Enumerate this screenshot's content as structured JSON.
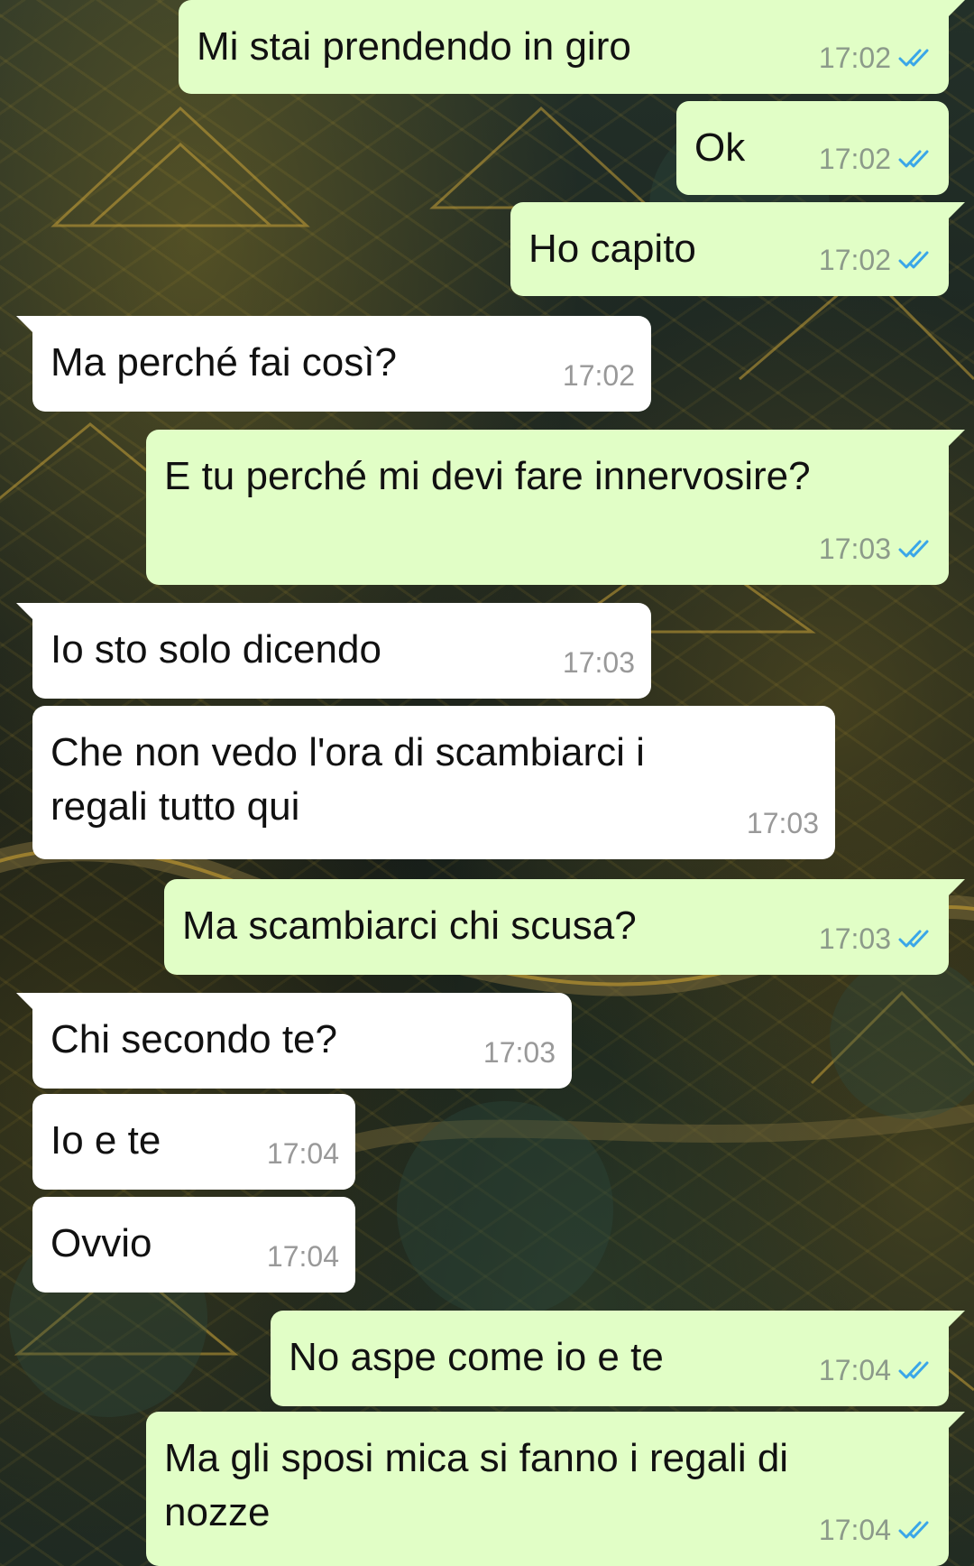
{
  "messages": [
    {
      "dir": "out",
      "text": "Mi stai prendendo in giro",
      "time": "17:02",
      "status": "read"
    },
    {
      "dir": "out",
      "text": "Ok",
      "time": "17:02",
      "status": "read"
    },
    {
      "dir": "out",
      "text": "Ho capito",
      "time": "17:02",
      "status": "read"
    },
    {
      "dir": "in",
      "text": "Ma perché fai così?",
      "time": "17:02"
    },
    {
      "dir": "out",
      "text": "E tu perché mi devi fare innervosire?",
      "time": "17:03",
      "status": "read"
    },
    {
      "dir": "in",
      "text": "Io sto solo dicendo",
      "time": "17:03"
    },
    {
      "dir": "in",
      "text": "Che non vedo l'ora di scambiarci i regali tutto qui",
      "time": "17:03"
    },
    {
      "dir": "out",
      "text": "Ma scambiarci chi scusa?",
      "time": "17:03",
      "status": "read"
    },
    {
      "dir": "in",
      "text": "Chi secondo te?",
      "time": "17:03"
    },
    {
      "dir": "in",
      "text": "Io e te",
      "time": "17:04"
    },
    {
      "dir": "in",
      "text": "Ovvio",
      "time": "17:04"
    },
    {
      "dir": "out",
      "text": "No aspe come io e te",
      "time": "17:04",
      "status": "read"
    },
    {
      "dir": "out",
      "text": "Ma gli sposi mica si fanno i regali di nozze",
      "time": "17:04",
      "status": "read"
    }
  ],
  "colors": {
    "outgoing_bubble": "#e1fec6",
    "incoming_bubble": "#ffffff",
    "read_tick": "#3aa6e8"
  }
}
